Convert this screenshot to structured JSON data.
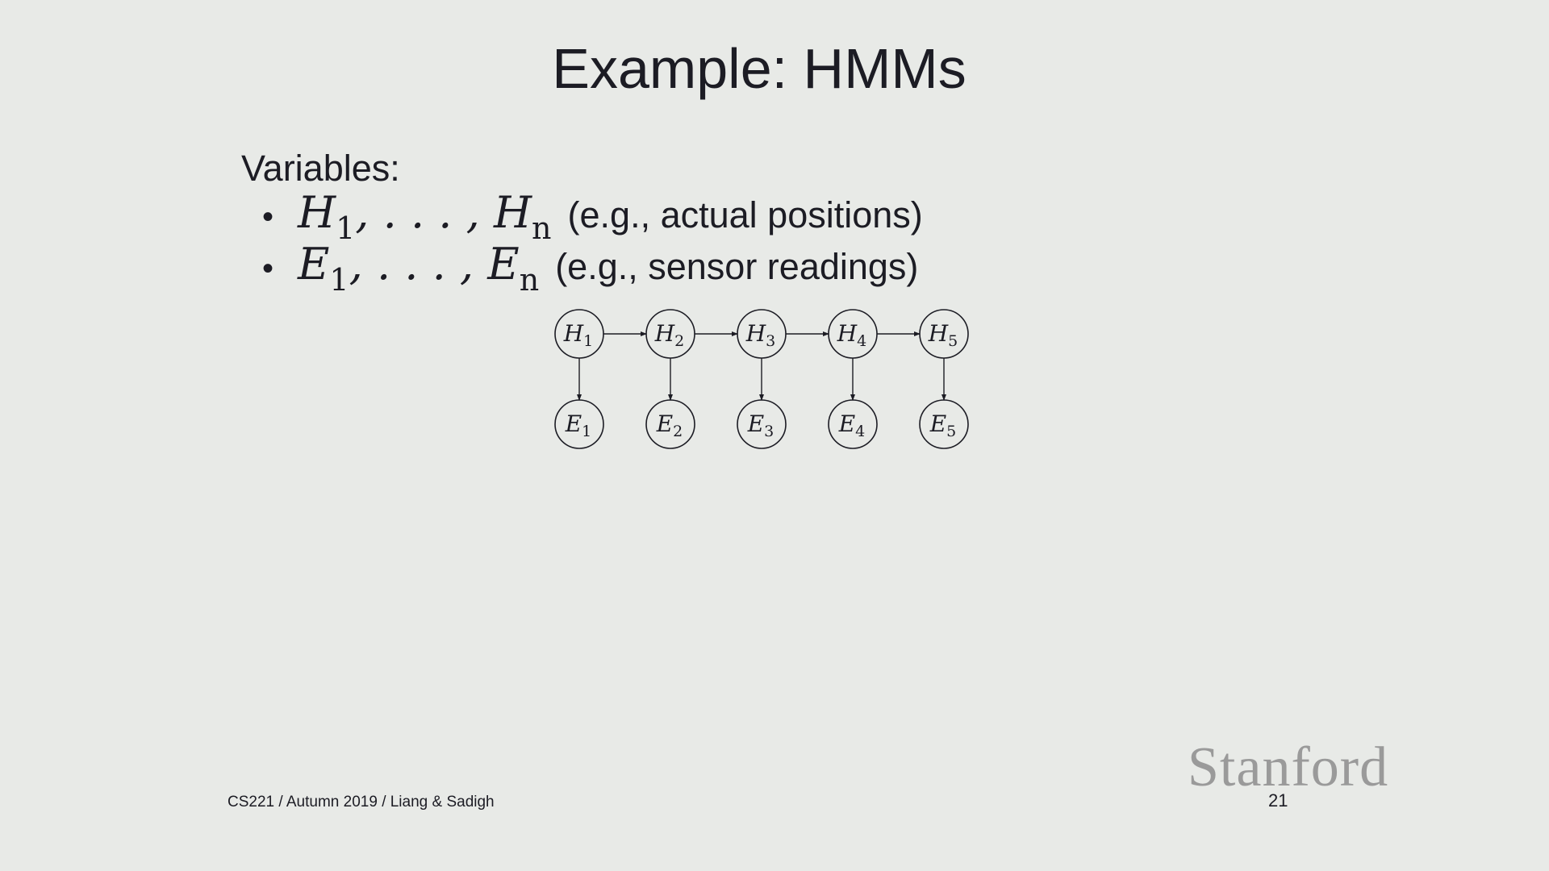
{
  "slide": {
    "title": "Example: HMMs",
    "heading": "Variables:",
    "bullets": [
      {
        "symbol": "H",
        "first_sub": "1",
        "ellipsis": ", . . . ,",
        "last_sub": "n",
        "text": "(e.g., actual positions)"
      },
      {
        "symbol": "E",
        "first_sub": "1",
        "ellipsis": ", . . . ,",
        "last_sub": "n",
        "text": "(e.g., sensor readings)"
      }
    ]
  },
  "diagram": {
    "hidden_nodes": [
      {
        "letter": "H",
        "index": "1"
      },
      {
        "letter": "H",
        "index": "2"
      },
      {
        "letter": "H",
        "index": "3"
      },
      {
        "letter": "H",
        "index": "4"
      },
      {
        "letter": "H",
        "index": "5"
      }
    ],
    "evidence_nodes": [
      {
        "letter": "E",
        "index": "1"
      },
      {
        "letter": "E",
        "index": "2"
      },
      {
        "letter": "E",
        "index": "3"
      },
      {
        "letter": "E",
        "index": "4"
      },
      {
        "letter": "E",
        "index": "5"
      }
    ]
  },
  "footer": {
    "course": "CS221 / Autumn 2019 / Liang & Sadigh",
    "logo": "Stanford",
    "page_number": "21"
  }
}
